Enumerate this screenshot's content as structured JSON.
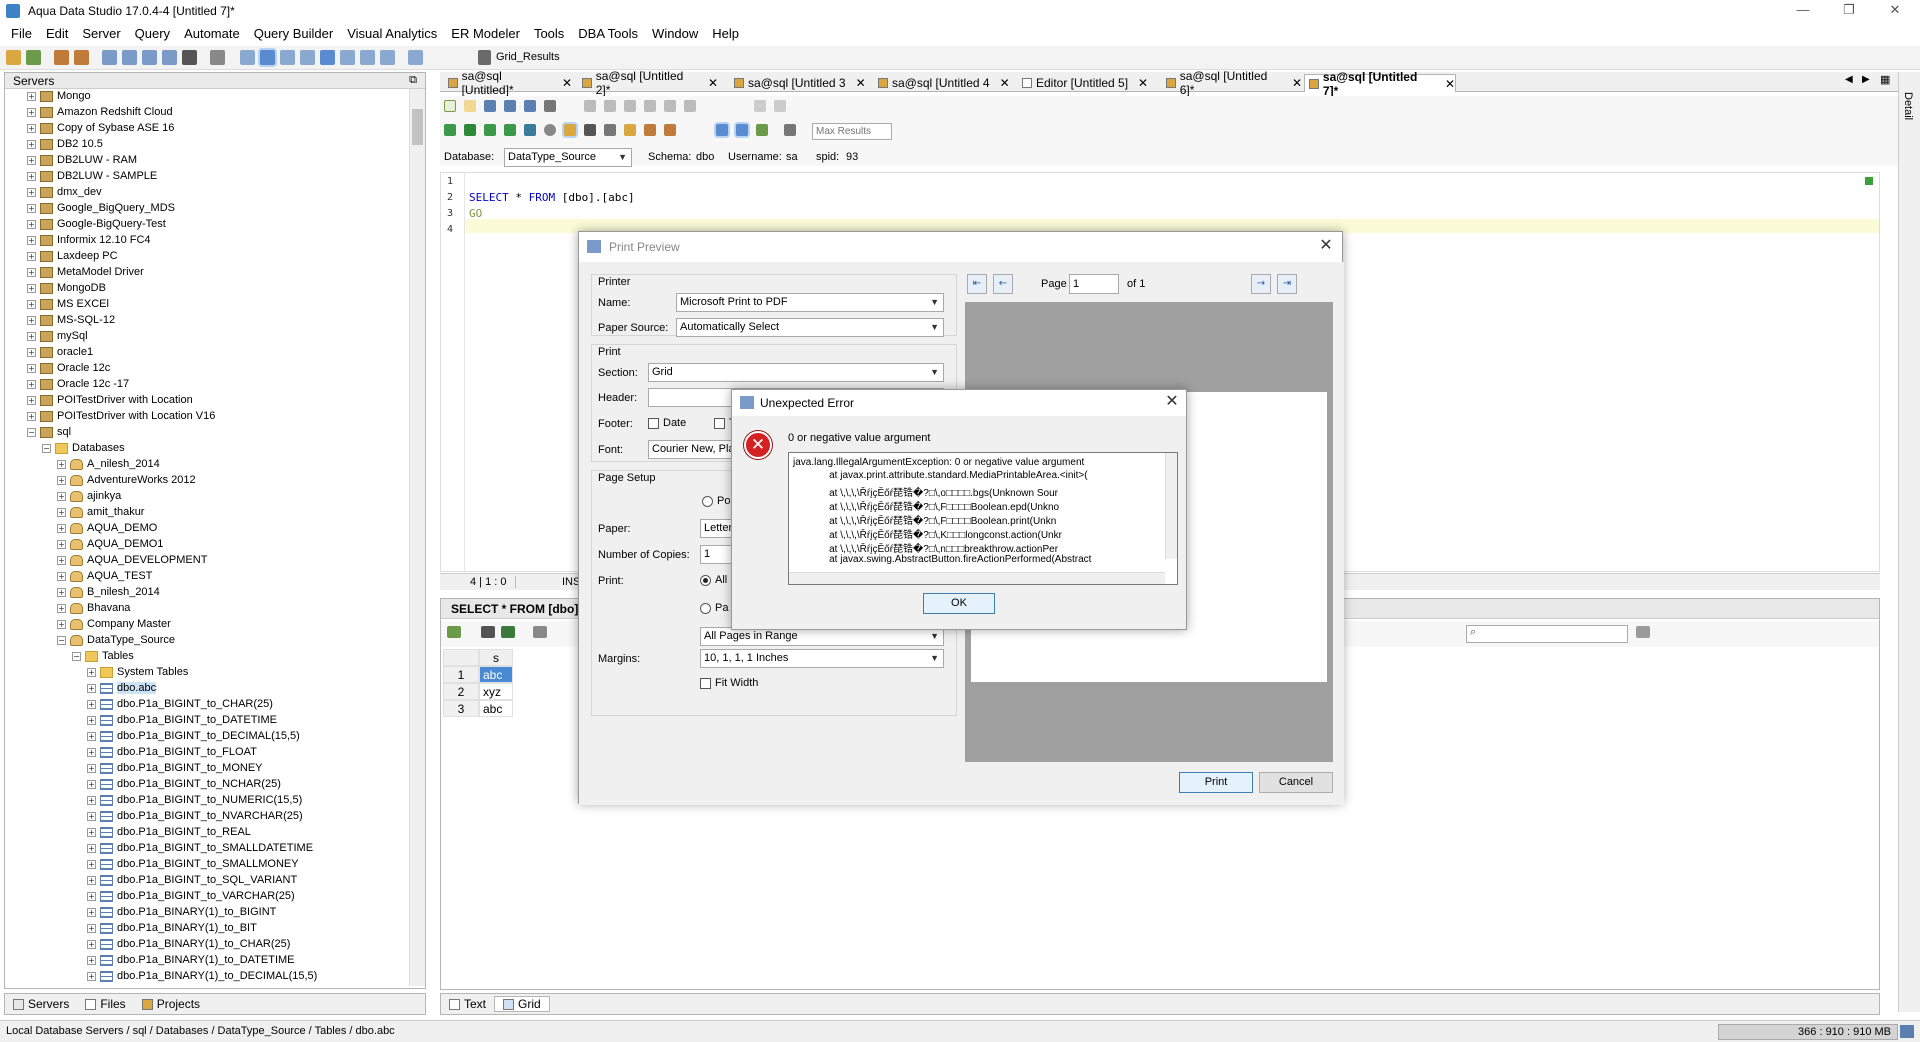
{
  "window": {
    "title": "Aqua Data Studio 17.0.4-4 [Untitled 7]*"
  },
  "menu": [
    "File",
    "Edit",
    "Server",
    "Query",
    "Automate",
    "Query Builder",
    "Visual Analytics",
    "ER Modeler",
    "Tools",
    "DBA Tools",
    "Window",
    "Help"
  ],
  "toolbar": {
    "grid_results_label": "Grid_Results"
  },
  "servers_panel": {
    "title": "Servers",
    "tree": [
      {
        "label": "Mongo",
        "icon": "server"
      },
      {
        "label": "Amazon Redshift Cloud",
        "icon": "server"
      },
      {
        "label": "Copy of Sybase ASE 16",
        "icon": "server"
      },
      {
        "label": "DB2 10.5",
        "icon": "server"
      },
      {
        "label": "DB2LUW - RAM",
        "icon": "server"
      },
      {
        "label": "DB2LUW - SAMPLE",
        "icon": "server"
      },
      {
        "label": "dmx_dev",
        "icon": "server"
      },
      {
        "label": "Google_BigQuery_MDS",
        "icon": "server"
      },
      {
        "label": "Google-BigQuery-Test",
        "icon": "server"
      },
      {
        "label": "Informix 12.10 FC4",
        "icon": "server"
      },
      {
        "label": "Laxdeep PC",
        "icon": "server"
      },
      {
        "label": "MetaModel Driver",
        "icon": "server"
      },
      {
        "label": "MongoDB",
        "icon": "server"
      },
      {
        "label": "MS EXCEl",
        "icon": "server"
      },
      {
        "label": "MS-SQL-12",
        "icon": "server"
      },
      {
        "label": "mySql",
        "icon": "server"
      },
      {
        "label": "oracle1",
        "icon": "server"
      },
      {
        "label": "Oracle 12c",
        "icon": "server"
      },
      {
        "label": "Oracle 12c -17",
        "icon": "server"
      },
      {
        "label": "POITestDriver with Location",
        "icon": "server"
      },
      {
        "label": "POITestDriver with Location V16",
        "icon": "server"
      },
      {
        "label": "sql",
        "icon": "server"
      },
      {
        "label": "Databases",
        "icon": "folder"
      },
      {
        "label": "A_nilesh_2014",
        "icon": "db"
      },
      {
        "label": "AdventureWorks 2012",
        "icon": "db"
      },
      {
        "label": "ajinkya",
        "icon": "db"
      },
      {
        "label": "amit_thakur",
        "icon": "db"
      },
      {
        "label": "AQUA_DEMO",
        "icon": "db"
      },
      {
        "label": "AQUA_DEMO1",
        "icon": "db"
      },
      {
        "label": "AQUA_DEVELOPMENT",
        "icon": "db"
      },
      {
        "label": "AQUA_TEST",
        "icon": "db"
      },
      {
        "label": "B_nilesh_2014",
        "icon": "db"
      },
      {
        "label": "Bhavana",
        "icon": "db"
      },
      {
        "label": "Company Master",
        "icon": "db"
      },
      {
        "label": "DataType_Source",
        "icon": "db"
      },
      {
        "label": "Tables",
        "icon": "folder"
      },
      {
        "label": "System Tables",
        "icon": "folder"
      },
      {
        "label": "dbo.abc",
        "icon": "table"
      },
      {
        "label": "dbo.P1a_BIGINT_to_CHAR(25)",
        "icon": "table"
      },
      {
        "label": "dbo.P1a_BIGINT_to_DATETIME",
        "icon": "table"
      },
      {
        "label": "dbo.P1a_BIGINT_to_DECIMAL(15,5)",
        "icon": "table"
      },
      {
        "label": "dbo.P1a_BIGINT_to_FLOAT",
        "icon": "table"
      },
      {
        "label": "dbo.P1a_BIGINT_to_MONEY",
        "icon": "table"
      },
      {
        "label": "dbo.P1a_BIGINT_to_NCHAR(25)",
        "icon": "table"
      },
      {
        "label": "dbo.P1a_BIGINT_to_NUMERIC(15,5)",
        "icon": "table"
      },
      {
        "label": "dbo.P1a_BIGINT_to_NVARCHAR(25)",
        "icon": "table"
      },
      {
        "label": "dbo.P1a_BIGINT_to_REAL",
        "icon": "table"
      },
      {
        "label": "dbo.P1a_BIGINT_to_SMALLDATETIME",
        "icon": "table"
      },
      {
        "label": "dbo.P1a_BIGINT_to_SMALLMONEY",
        "icon": "table"
      },
      {
        "label": "dbo.P1a_BIGINT_to_SQL_VARIANT",
        "icon": "table"
      },
      {
        "label": "dbo.P1a_BIGINT_to_VARCHAR(25)",
        "icon": "table"
      },
      {
        "label": "dbo.P1a_BINARY(1)_to_BIGINT",
        "icon": "table"
      },
      {
        "label": "dbo.P1a_BINARY(1)_to_BIT",
        "icon": "table"
      },
      {
        "label": "dbo.P1a_BINARY(1)_to_CHAR(25)",
        "icon": "table"
      },
      {
        "label": "dbo.P1a_BINARY(1)_to_DATETIME",
        "icon": "table"
      },
      {
        "label": "dbo.P1a_BINARY(1)_to_DECIMAL(15,5)",
        "icon": "table"
      }
    ],
    "bottom_tabs": [
      "Servers",
      "Files",
      "Projects"
    ]
  },
  "editor_tabs": [
    "sa@sql [Untitled]*",
    "sa@sql [Untitled 2]*",
    "sa@sql [Untitled 3",
    "sa@sql [Untitled 4",
    "Editor [Untitled 5]",
    "sa@sql [Untitled 6]*",
    "sa@sql [Untitled 7]*"
  ],
  "connection": {
    "database_label": "Database:",
    "database": "DataType_Source",
    "schema_label": "Schema:",
    "schema": "dbo",
    "username_label": "Username:",
    "username": "sa",
    "spid_label": "spid:",
    "spid": "93",
    "max_results_placeholder": "Max Results"
  },
  "editor": {
    "line_numbers": [
      "1",
      "2",
      "3",
      "4"
    ],
    "line2_kw1": "SELECT",
    "line2_mid": " * ",
    "line2_kw2": "FROM",
    "line2_rest": " [dbo].[abc]",
    "line3": "GO",
    "position": "4 | 1 : 0",
    "mode": "INS"
  },
  "results": {
    "header": "SELECT * FROM [dbo].[",
    "column": "s",
    "rows": [
      {
        "n": "1",
        "v": "abc"
      },
      {
        "n": "2",
        "v": "xyz"
      },
      {
        "n": "3",
        "v": "abc"
      }
    ],
    "tabs": [
      "Text",
      "Grid"
    ]
  },
  "detail_tab": "Detail",
  "status": {
    "path": "Local Database Servers / sql / Databases / DataType_Source / Tables / dbo.abc",
    "memory": "366 : 910 : 910 MB"
  },
  "print_preview": {
    "title": "Print Preview",
    "printer_group": "Printer",
    "name_label": "Name:",
    "name": "Microsoft Print to PDF",
    "paper_source_label": "Paper Source:",
    "paper_source": "Automatically Select",
    "print_group": "Print",
    "section_label": "Section:",
    "section": "Grid",
    "header_label": "Header:",
    "footer_label": "Footer:",
    "date_label": "Date",
    "footer_t": "T",
    "font_label": "Font:",
    "font": "Courier New, Pla",
    "page_setup_group": "Page Setup",
    "orientation": "Po",
    "paper_label": "Paper:",
    "paper": "Letter",
    "copies_label": "Number of Copies:",
    "copies": "1",
    "print_label": "Print:",
    "print_all": "All",
    "print_pages": "Pa",
    "range": "All Pages in Range",
    "margins_label": "Margins:",
    "margins": "10, 1, 1, 1 Inches",
    "fit_width_label": "Fit Width",
    "page_label": "Page",
    "page_value": "1",
    "of_label": "of 1",
    "print_button": "Print",
    "cancel_button": "Cancel"
  },
  "error_dialog": {
    "title": "Unexpected Error",
    "message": "0 or negative value argument",
    "trace": [
      "java.lang.IllegalArgumentException: 0 or negative value argument",
      "             at javax.print.attribute.standard.MediaPrintableArea.<init>(",
      "             at \\,\\,\\,\\ŘŕįçĔőŕ琵锆�?□\\,o□□□□.bgs(Unknown Sour",
      "             at \\,\\,\\,\\ŘŕįçĔőŕ琵锆�?□\\,F□□□□Boolean.epd(Unkno",
      "             at \\,\\,\\,\\ŘŕįçĔőŕ琵锆�?□\\,F□□□□Boolean.print(Unkn",
      "             at \\,\\,\\,\\ŘŕįçĔőŕ琵锆�?□\\,K□□□longconst.action(Unkr",
      "             at \\,\\,\\,\\ŘŕįçĔőŕ琵锆�?□\\,n□□□breakthrow.actionPer",
      "             at javax.swing.AbstractButton.fireActionPerformed(Abstract"
    ],
    "ok_button": "OK"
  }
}
